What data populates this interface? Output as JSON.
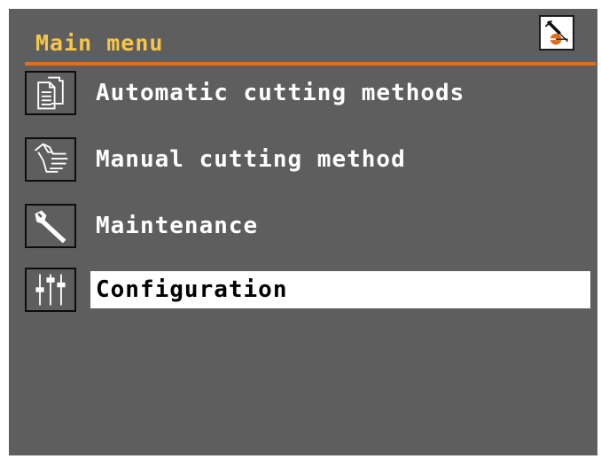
{
  "header": {
    "title": "Main menu",
    "status_icon": "cutting-status-icon"
  },
  "menu": {
    "items": [
      {
        "label": "Automatic cutting methods",
        "icon": "document-icon",
        "selected": false
      },
      {
        "label": "Manual cutting method",
        "icon": "hand-icon",
        "selected": false
      },
      {
        "label": "Maintenance",
        "icon": "wrench-icon",
        "selected": false
      },
      {
        "label": "Configuration",
        "icon": "sliders-icon",
        "selected": true
      }
    ]
  },
  "colors": {
    "background": "#5e5e5e",
    "accent": "#e36c1a",
    "title_text": "#f5c64a",
    "item_text": "#ffffff",
    "selected_bg": "#ffffff",
    "selected_text": "#000000"
  }
}
